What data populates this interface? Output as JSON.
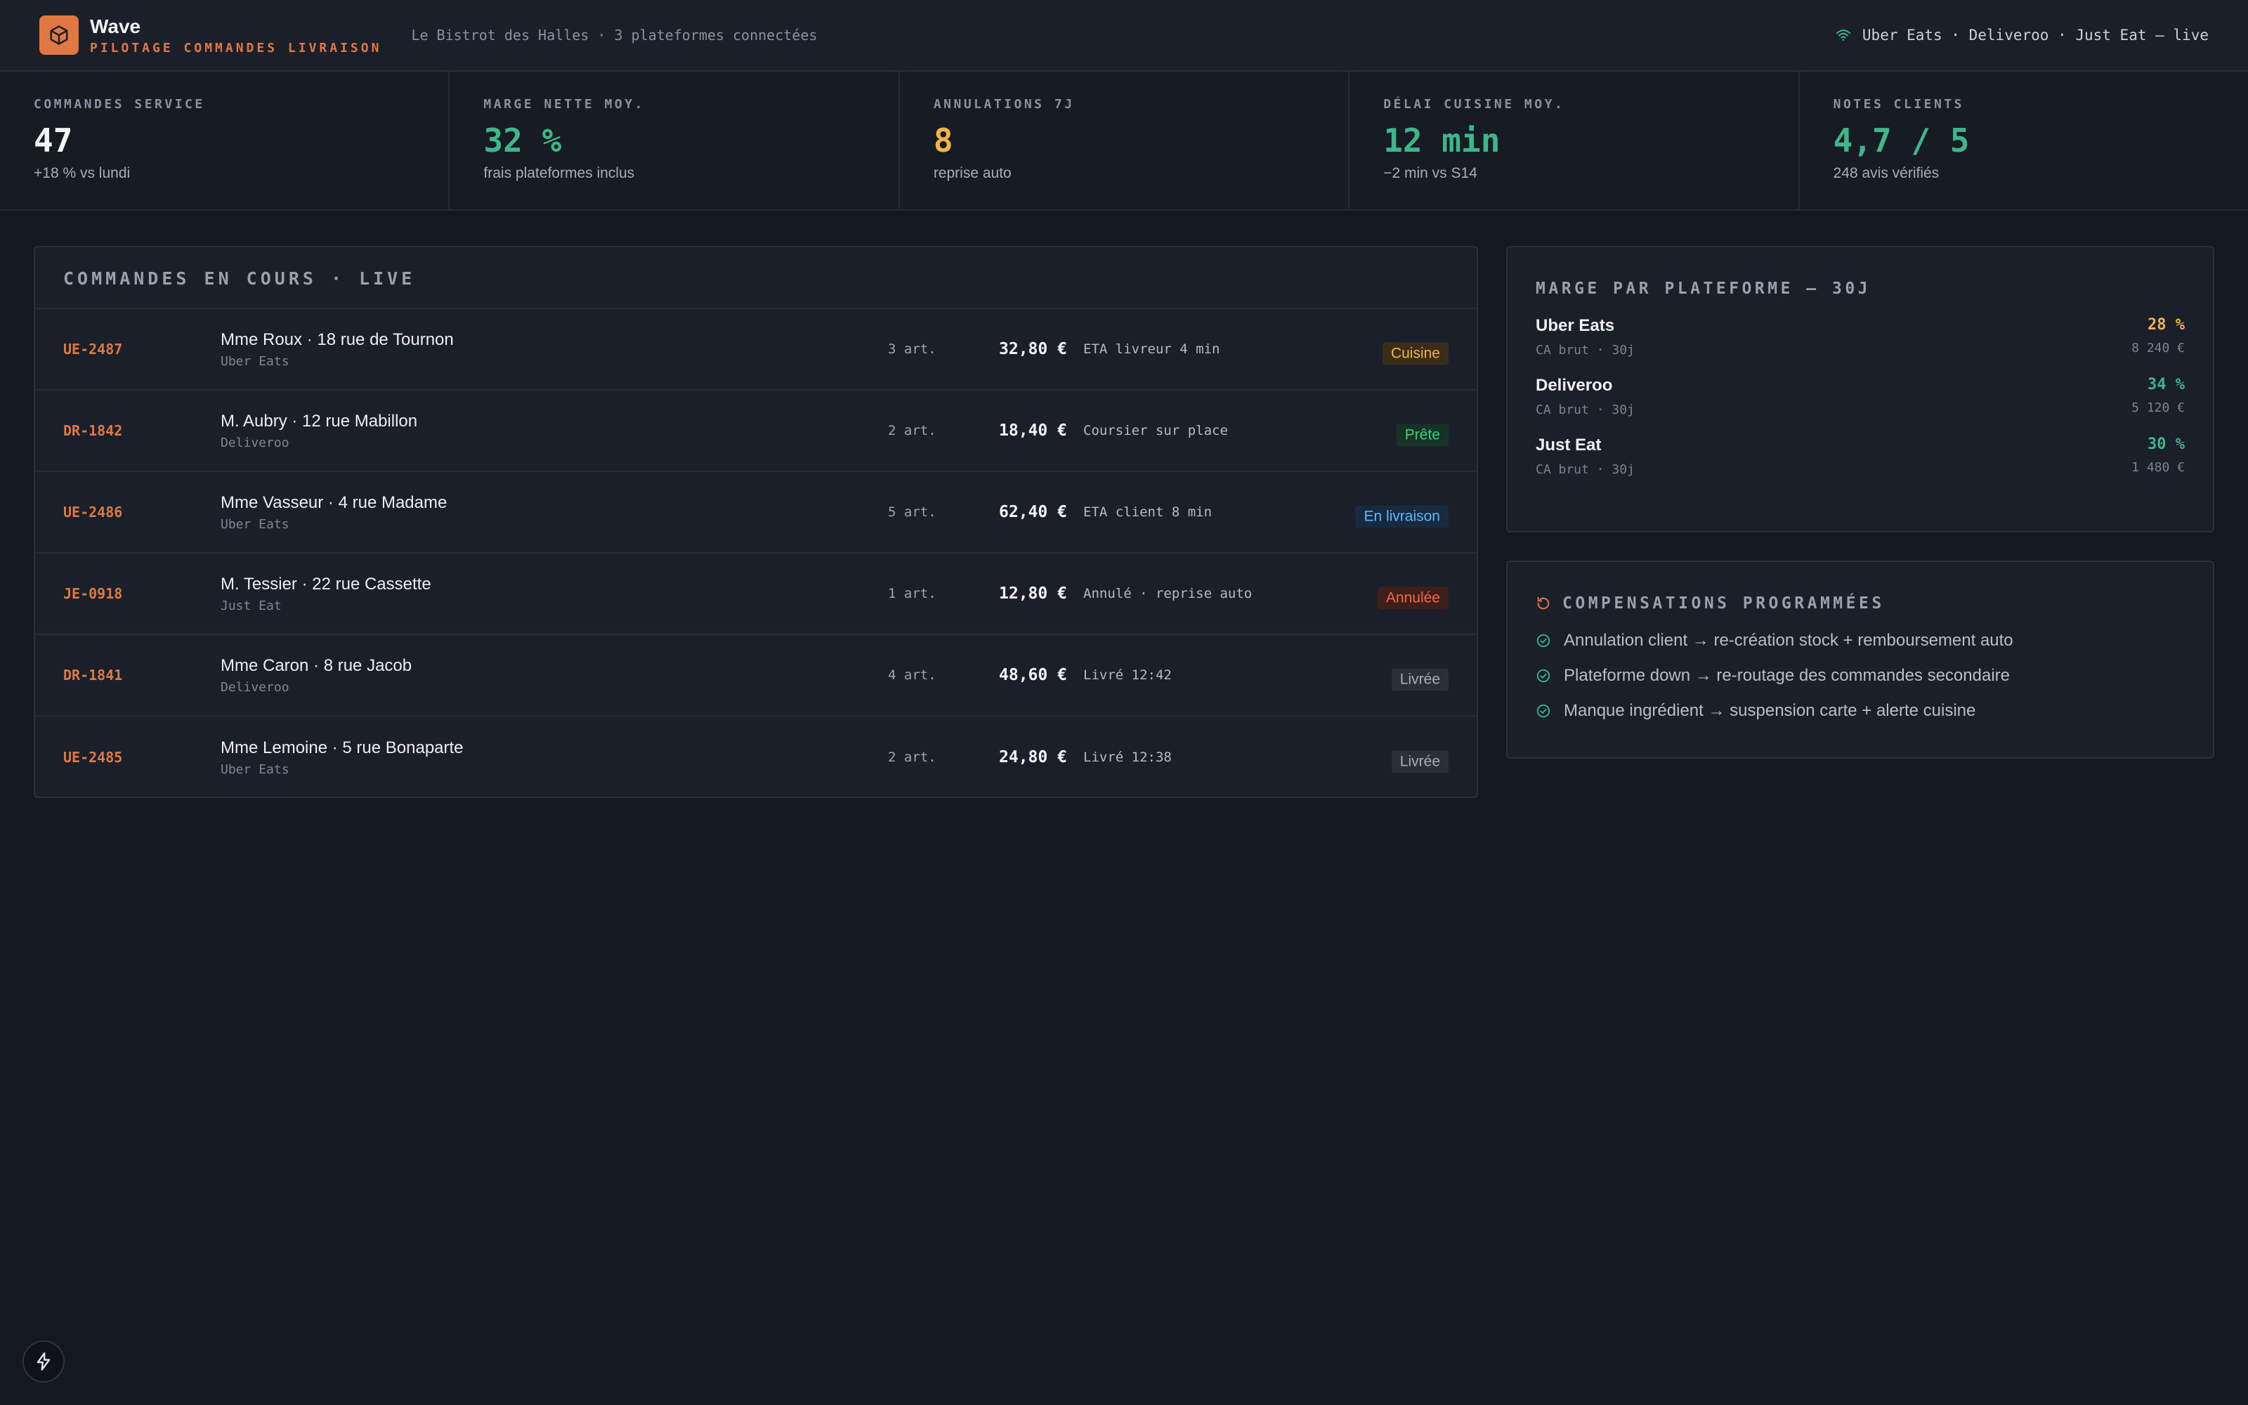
{
  "header": {
    "brand_name": "Wave",
    "brand_subtitle": "PILOTAGE COMMANDES LIVRAISON",
    "context": "Le Bistrot des Halles · 3 plateformes connectées",
    "live_status": "Uber Eats · Deliveroo · Just Eat — live"
  },
  "kpis": [
    {
      "label": "COMMANDES SERVICE",
      "value": "47",
      "sub": "+18 % vs lundi"
    },
    {
      "label": "MARGE NETTE MOY.",
      "value": "32 %",
      "sub": "frais plateformes inclus"
    },
    {
      "label": "ANNULATIONS 7J",
      "value": "8",
      "sub": "reprise auto"
    },
    {
      "label": "DÉLAI CUISINE MOY.",
      "value": "12 min",
      "sub": "−2 min vs S14"
    },
    {
      "label": "NOTES CLIENTS",
      "value": "4,7 / 5",
      "sub": "248 avis vérifiés"
    }
  ],
  "orders": {
    "title": "COMMANDES EN COURS · LIVE",
    "rows": [
      {
        "id": "UE-2487",
        "customer": "Mme Roux · 18 rue de Tournon",
        "platform": "Uber Eats",
        "items": "3 art.",
        "price": "32,80 €",
        "status": "ETA livreur 4 min",
        "badge": "Cuisine"
      },
      {
        "id": "DR-1842",
        "customer": "M. Aubry · 12 rue Mabillon",
        "platform": "Deliveroo",
        "items": "2 art.",
        "price": "18,40 €",
        "status": "Coursier sur place",
        "badge": "Prête"
      },
      {
        "id": "UE-2486",
        "customer": "Mme Vasseur · 4 rue Madame",
        "platform": "Uber Eats",
        "items": "5 art.",
        "price": "62,40 €",
        "status": "ETA client 8 min",
        "badge": "En livraison"
      },
      {
        "id": "JE-0918",
        "customer": "M. Tessier · 22 rue Cassette",
        "platform": "Just Eat",
        "items": "1 art.",
        "price": "12,80 €",
        "status": "Annulé · reprise auto",
        "badge": "Annulée"
      },
      {
        "id": "DR-1841",
        "customer": "Mme Caron · 8 rue Jacob",
        "platform": "Deliveroo",
        "items": "4 art.",
        "price": "48,60 €",
        "status": "Livré 12:42",
        "badge": "Livrée"
      },
      {
        "id": "UE-2485",
        "customer": "Mme Lemoine · 5 rue Bonaparte",
        "platform": "Uber Eats",
        "items": "2 art.",
        "price": "24,80 €",
        "status": "Livré 12:38",
        "badge": "Livrée"
      }
    ]
  },
  "margins": {
    "title": "MARGE PAR PLATEFORME — 30J",
    "rows": [
      {
        "name": "Uber Eats",
        "sub": "CA brut · 30j",
        "pct": "28 %",
        "amount": "8 240 €"
      },
      {
        "name": "Deliveroo",
        "sub": "CA brut · 30j",
        "pct": "34 %",
        "amount": "5 120 €"
      },
      {
        "name": "Just Eat",
        "sub": "CA brut · 30j",
        "pct": "30 %",
        "amount": "1 480 €"
      }
    ]
  },
  "compensations": {
    "title": "COMPENSATIONS PROGRAMMÉES",
    "items": [
      "Annulation client → re-création stock + remboursement auto",
      "Plateforme down → re-routage des commandes secondaire",
      "Manque ingrédient → suspension carte + alerte cuisine"
    ]
  },
  "colors": {
    "accent": "#e07844",
    "green": "#3fb58a",
    "amber": "#f2b24c"
  }
}
